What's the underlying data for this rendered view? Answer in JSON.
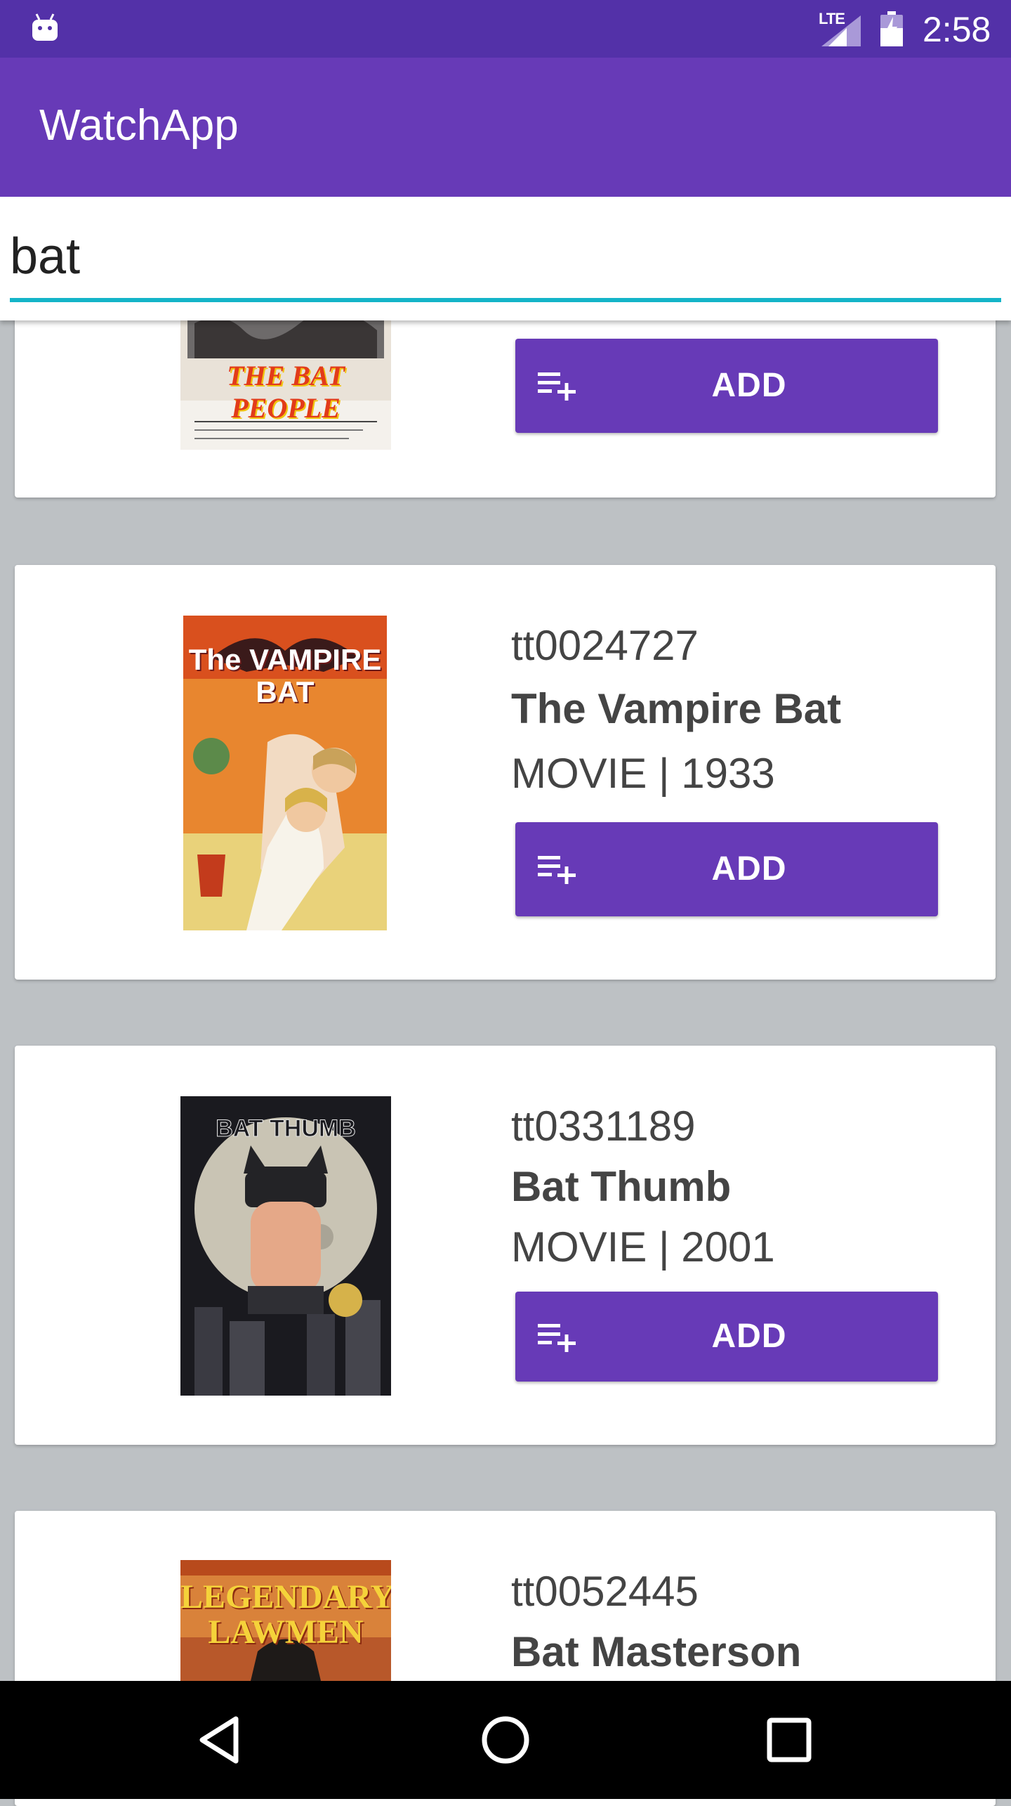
{
  "status_bar": {
    "network": "LTE",
    "time": "2:58"
  },
  "app_bar": {
    "title": "WatchApp"
  },
  "search": {
    "value": "bat"
  },
  "results": [
    {
      "id": "",
      "title": "",
      "meta": "",
      "add_label": "ADD",
      "poster_text": "THE BAT PEOPLE"
    },
    {
      "id": "tt0024727",
      "title": "The Vampire Bat",
      "meta": "MOVIE | 1933",
      "add_label": "ADD",
      "poster_text": "The VAMPIRE BAT"
    },
    {
      "id": "tt0331189",
      "title": "Bat Thumb",
      "meta": "MOVIE | 2001",
      "add_label": "ADD",
      "poster_text": "BAT THUMB"
    },
    {
      "id": "tt0052445",
      "title": "Bat Masterson",
      "meta": "",
      "add_label": "",
      "poster_text": "LEGENDARY LAWMEN"
    }
  ],
  "colors": {
    "primary": "#673ab7",
    "primary_dark": "#5331a8",
    "accent": "#14b4c8",
    "background": "#bdc1c4"
  },
  "icons": [
    "android-icon",
    "signal-icon",
    "battery-icon",
    "playlist-add-icon",
    "back-icon",
    "home-icon",
    "recents-icon"
  ]
}
